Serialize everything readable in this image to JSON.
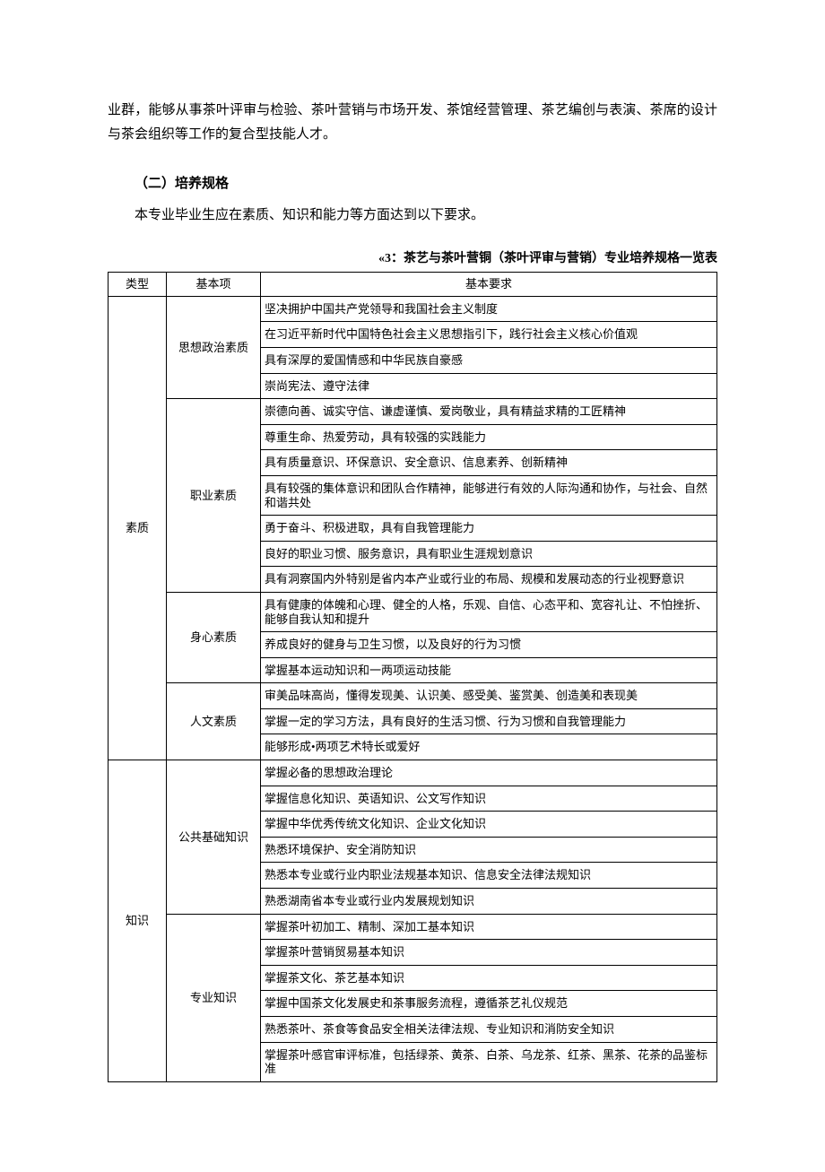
{
  "intro_paragraph": "业群，能够从事茶叶评审与检验、茶叶营销与市场开发、茶馆经营管理、茶艺编创与表演、茶席的设计与茶会组织等工作的复合型技能人才。",
  "section_heading": "（二）培养规格",
  "lead_sentence": "本专业毕业生应在素质、知识和能力等方面达到以下要求。",
  "table_caption": "«3：茶艺与茶叶营铜（茶叶评审与营销）专业培养规格一览表",
  "header": {
    "type": "类型",
    "item": "基本项",
    "req": "基本要求"
  },
  "sections": [
    {
      "type": "素质",
      "groups": [
        {
          "item": "思想政治素质",
          "reqs": [
            "坚决拥护中国共产党领导和我国社会主义制度",
            "在习近平新时代中国特色社会主义思想指引下，践行社会主义核心价值观",
            "具有深厚的爱国情感和中华民族自豪感",
            "崇尚宪法、遵守法律"
          ]
        },
        {
          "item": "职业素质",
          "reqs": [
            "崇德向善、诚实守信、谦虚谨慎、爱岗敬业，具有精益求精的工匠精神",
            "尊重生命、热爱劳动，具有较强的实践能力",
            "具有质量意识、环保意识、安全意识、信息素养、创新精神",
            "具有较强的集体意识和团队合作精神，能够进行有效的人际沟通和协作，与社会、自然和谐共处",
            "勇于奋斗、积极进取，具有自我管理能力",
            "良好的职业习惯、服务意识，具有职业生涯规划意识",
            "具有洞察国内外特别是省内本产业或行业的布局、规模和发展动态的行业视野意识"
          ]
        },
        {
          "item": "身心素质",
          "reqs": [
            "具有健康的体魄和心理、健全的人格，乐观、自信、心态平和、宽容礼让、不怕挫折、能够自我认知和提升",
            "养成良好的健身与卫生习惯，以及良好的行为习惯",
            "掌握基本运动知识和一两项运动技能"
          ]
        },
        {
          "item": "人文素质",
          "reqs": [
            "审美品味高尚，懂得发现美、认识美、感受美、鉴赏美、创造美和表现美",
            "掌握一定的学习方法，具有良好的生活习惯、行为习惯和自我管理能力",
            "能够形成•两项艺术特长或爱好"
          ]
        }
      ]
    },
    {
      "type": "知识",
      "groups": [
        {
          "item": "公共基础知识",
          "reqs": [
            "掌握必备的思想政治理论",
            "掌握信息化知识、英语知识、公文写作知识",
            "掌握中华优秀传统文化知识、企业文化知识",
            "熟悉环境保护、安全消防知识",
            "熟悉本专业或行业内职业法规基本知识、信息安全法律法规知识",
            "熟悉湖南省本专业或行业内发展规划知识"
          ]
        },
        {
          "item": "专业知识",
          "reqs": [
            "掌握茶叶初加工、精制、深加工基本知识",
            "掌握茶叶营销贸易基本知识",
            "掌握茶文化、茶艺基本知识",
            "掌握中国茶文化发展史和茶事服务流程，遵循茶艺礼仪规范",
            "熟悉茶叶、茶食等食品安全相关法律法规、专业知识和消防安全知识",
            "掌握茶叶感官审评标准，包括绿茶、黄茶、白茶、乌龙茶、红茶、黑茶、花茶的品鉴标准"
          ]
        }
      ]
    }
  ]
}
